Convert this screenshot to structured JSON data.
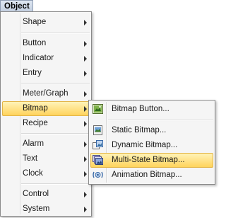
{
  "menubar": {
    "title": "Object"
  },
  "menu": {
    "items": [
      {
        "label": "Shape"
      },
      {
        "label": "Button"
      },
      {
        "label": "Indicator"
      },
      {
        "label": "Entry"
      },
      {
        "label": "Meter/Graph"
      },
      {
        "label": "Bitmap"
      },
      {
        "label": "Recipe"
      },
      {
        "label": "Alarm"
      },
      {
        "label": "Text"
      },
      {
        "label": "Clock"
      },
      {
        "label": "Control"
      },
      {
        "label": "System"
      }
    ]
  },
  "submenu": {
    "items": [
      {
        "label": "Bitmap Button...",
        "icon": "bitmap-button-icon"
      },
      {
        "label": "Static Bitmap...",
        "icon": "static-bitmap-icon"
      },
      {
        "label": "Dynamic Bitmap...",
        "icon": "dynamic-bitmap-icon"
      },
      {
        "label": "Multi-State Bitmap...",
        "icon": "multi-state-bitmap-icon"
      },
      {
        "label": "Animation Bitmap...",
        "icon": "animation-bitmap-icon"
      }
    ]
  },
  "colors": {
    "highlight_top": "#fff3b8",
    "highlight_bottom": "#ffd35c",
    "highlight_border": "#e3b446",
    "menu_bg": "#f5f5f5"
  }
}
